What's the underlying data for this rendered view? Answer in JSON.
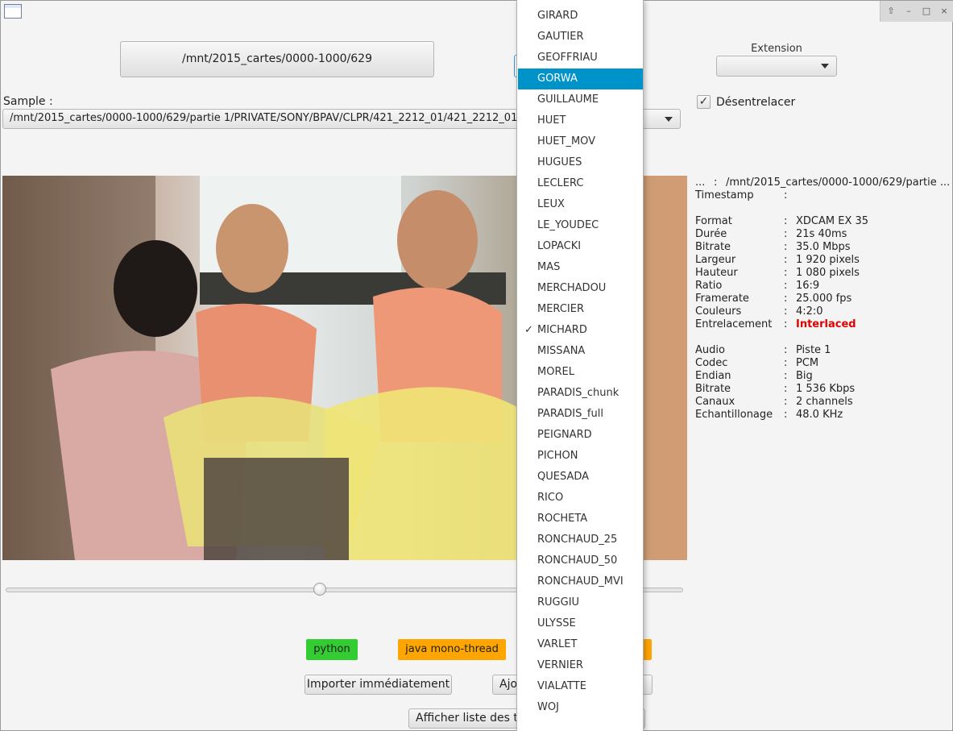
{
  "window": {
    "controls": [
      "⇧",
      "–",
      "□",
      "×"
    ]
  },
  "top": {
    "path_button": "/mnt/2015_cartes/0000-1000/629",
    "extension_label": "Extension",
    "extension_value": "",
    "deinterlace_label": "Désentrelacer",
    "deinterlace_checked": "✓"
  },
  "sample": {
    "label": "Sample :",
    "value": "/mnt/2015_cartes/0000-1000/629/partie 1/PRIVATE/SONY/BPAV/CLPR/421_2212_01/421_2212_01"
  },
  "slider": {
    "position": 0.465
  },
  "info": {
    "header_key": "...",
    "header_value": "/mnt/2015_cartes/0000-1000/629/partie ...",
    "rows": [
      {
        "k": "Timestamp",
        "v": ""
      },
      {
        "k": "Format",
        "v": "XDCAM EX 35"
      },
      {
        "k": "Durée",
        "v": "21s 40ms"
      },
      {
        "k": "Bitrate",
        "v": "35.0 Mbps"
      },
      {
        "k": "Largeur",
        "v": "1 920 pixels"
      },
      {
        "k": "Hauteur",
        "v": "1 080 pixels"
      },
      {
        "k": "Ratio",
        "v": "16:9"
      },
      {
        "k": "Framerate",
        "v": "25.000 fps"
      },
      {
        "k": "Couleurs",
        "v": "4:2:0"
      },
      {
        "k": "Entrelacement",
        "v": "Interlaced"
      },
      {
        "k": "Audio",
        "v": "Piste 1"
      },
      {
        "k": "Codec",
        "v": "PCM"
      },
      {
        "k": "Endian",
        "v": "Big"
      },
      {
        "k": "Bitrate",
        "v": "1 536 Kbps"
      },
      {
        "k": "Canaux",
        "v": "2 channels"
      },
      {
        "k": "Echantillonage",
        "v": "48.0 KHz"
      }
    ],
    "separator": ":"
  },
  "tags": {
    "python": "python",
    "java": "java mono-thread",
    "colors": {
      "python": "#33cc33",
      "java": "#ffa500"
    }
  },
  "buttons": {
    "import": "Importer immédiatement",
    "add": "Ajo",
    "list": "Afficher liste des ta"
  },
  "dropdown": {
    "selected": "GORWA",
    "checked": "MICHARD",
    "check_glyph": "✓",
    "highlight_color": "#0093c9",
    "items": [
      "GIRARD",
      "GAUTIER",
      "GEOFFRIAU",
      "GORWA",
      "GUILLAUME",
      "HUET",
      "HUET_MOV",
      "HUGUES",
      "LECLERC",
      "LEUX",
      "LE_YOUDEC",
      "LOPACKI",
      "MAS",
      "MERCHADOU",
      "MERCIER",
      "MICHARD",
      "MISSANA",
      "MOREL",
      "PARADIS_chunk",
      "PARADIS_full",
      "PEIGNARD",
      "PICHON",
      "QUESADA",
      "RICO",
      "ROCHETA",
      "RONCHAUD_25",
      "RONCHAUD_50",
      "RONCHAUD_MVI",
      "RUGGIU",
      "ULYSSE",
      "VARLET",
      "VERNIER",
      "VIALATTE",
      "WOJ"
    ]
  }
}
